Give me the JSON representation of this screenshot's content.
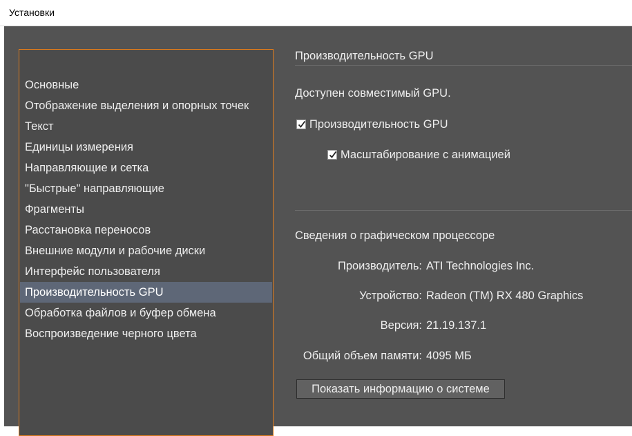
{
  "window": {
    "title": "Установки"
  },
  "sidebar": {
    "items": [
      {
        "label": "Основные"
      },
      {
        "label": "Отображение выделения и опорных точек"
      },
      {
        "label": "Текст"
      },
      {
        "label": "Единицы измерения"
      },
      {
        "label": "Направляющие и сетка"
      },
      {
        "label": "\"Быстрые\" направляющие"
      },
      {
        "label": "Фрагменты"
      },
      {
        "label": "Расстановка переносов"
      },
      {
        "label": "Внешние модули и рабочие диски"
      },
      {
        "label": "Интерфейс пользователя"
      },
      {
        "label": "Производительность GPU"
      },
      {
        "label": "Обработка файлов и буфер обмена"
      },
      {
        "label": "Воспроизведение черного цвета"
      }
    ],
    "selected_index": 10
  },
  "panel": {
    "title": "Производительность GPU",
    "compat_status": "Доступен совместимый GPU.",
    "gpu_performance": {
      "label": "Производительность GPU",
      "checked": true
    },
    "animated_zoom": {
      "label": "Масштабирование с анимацией",
      "checked": true
    },
    "gpu_info": {
      "title": "Сведения о графическом процессоре",
      "vendor": {
        "label": "Производитель:",
        "value": "ATI Technologies Inc."
      },
      "device": {
        "label": "Устройство:",
        "value": "Radeon (TM) RX 480 Graphics"
      },
      "version": {
        "label": "Версия:",
        "value": "21.19.137.1"
      },
      "memory": {
        "label": "Общий объем памяти:",
        "value": "4095 МБ"
      }
    },
    "show_system_info_button": "Показать информацию о системе"
  },
  "colors": {
    "window_bg": "#535353",
    "sidebar_border": "#e07c1b",
    "selection": "#5e6777",
    "text": "#eeeeee"
  }
}
